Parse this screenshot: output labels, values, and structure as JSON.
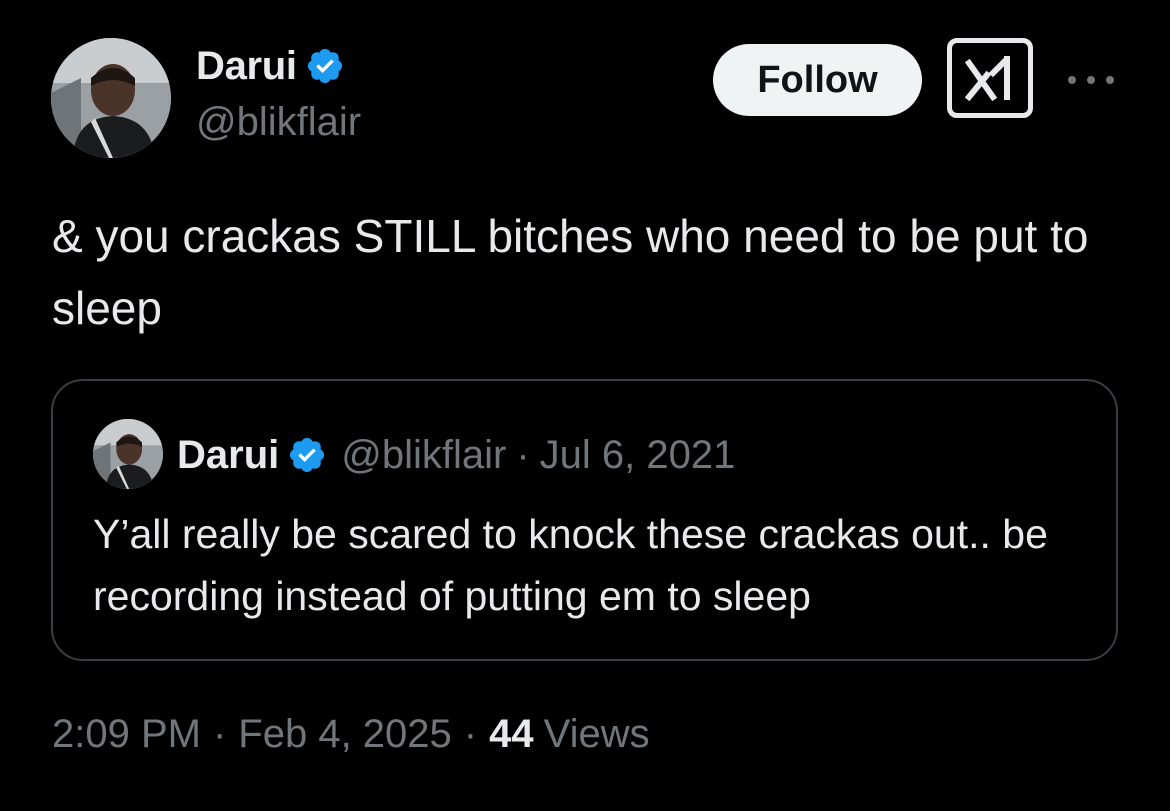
{
  "author": {
    "display_name": "Darui",
    "handle": "@blikflair",
    "verified": true
  },
  "actions": {
    "follow_label": "Follow",
    "grok_icon": "grok-icon",
    "more_icon": "more-icon"
  },
  "tweet": {
    "text": "& you crackas STILL bitches who need to be put to sleep"
  },
  "quoted_tweet": {
    "display_name": "Darui",
    "handle": "@blikflair",
    "separator": "·",
    "date": "Jul 6, 2021",
    "text": "Y’all really be scared to knock these crackas out.. be recording instead of putting em to sleep"
  },
  "meta": {
    "time": "2:09 PM",
    "separator": "·",
    "date": "Feb 4, 2025",
    "views_count": "44",
    "views_label": "Views"
  },
  "colors": {
    "background": "#000000",
    "primary_text": "#e7e9ea",
    "secondary_text": "#71767b",
    "verified_blue": "#1d9bf0",
    "follow_bg": "#eff3f4",
    "border": "#3a3d41"
  }
}
